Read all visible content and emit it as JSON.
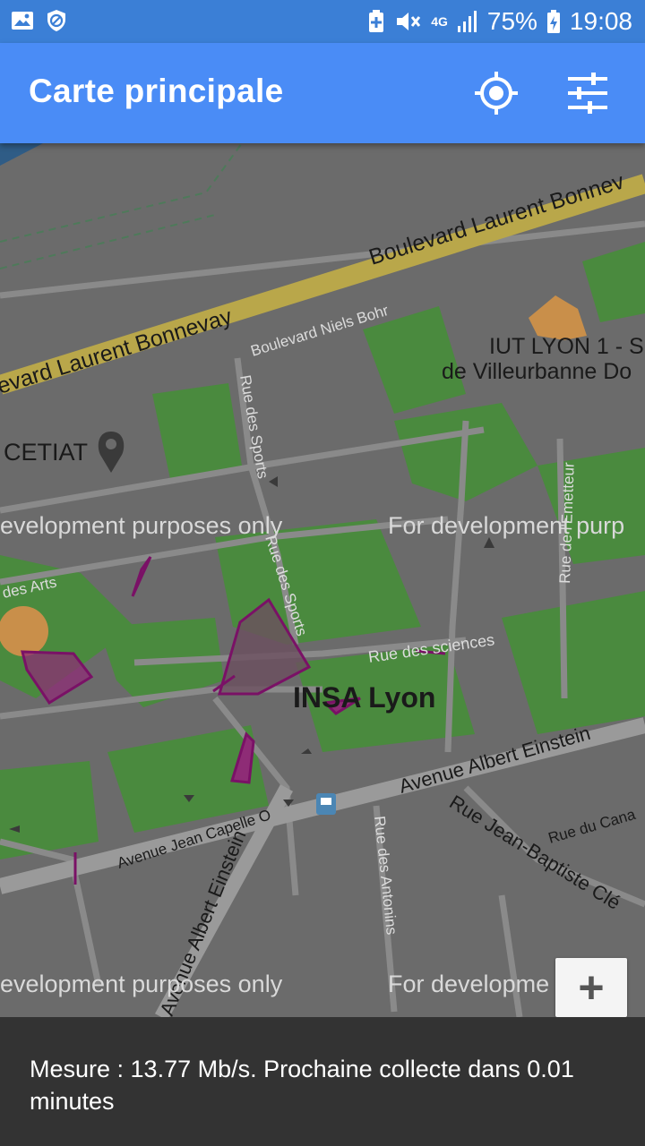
{
  "status_bar": {
    "battery": "75%",
    "network": "4G",
    "time": "19:08",
    "left_icons": [
      "image-icon",
      "shield-icon"
    ],
    "right_icons": [
      "battery-saver-icon",
      "mute-icon",
      "network-4g-icon",
      "signal-icon",
      "battery-charging-icon"
    ]
  },
  "app_bar": {
    "title": "Carte principale",
    "actions": [
      "locate-icon",
      "filter-settings-icon"
    ]
  },
  "map": {
    "watermark": "For development purposes only",
    "watermark_partial": "evelopment purposes only",
    "watermark_partial_right": "For development purp",
    "watermark_partial_right_2": "For developme",
    "labels": {
      "boulevard_laurent_bonnevay_1": "evard Laurent Bonnevay",
      "boulevard_laurent_bonnevay_2": "Boulevard Laurent Bonnev",
      "boulevard_niels_bohr": "Boulevard Niels Bohr",
      "iut_1": "IUT LYON 1 - S",
      "iut_2": "de Villeurbanne Do",
      "cetiat": "CETIAT",
      "rue_des_sports_1": "Rue des Sports",
      "rue_des_sports_2": "Rue des Sports",
      "rue_emetteur": "Rue de l'Emetteur",
      "rue_des_arts": "des Arts",
      "rue_des_sciences": "Rue des sciences",
      "insa": "INSA Lyon",
      "avenue_albert_einstein_1": "Avenue Albert Einstein",
      "avenue_jean_capelle": "Avenue Jean Capelle O",
      "rue_jean_baptiste": "Rue Jean-Baptiste Clé",
      "rue_du_canal": "Rue du Cana",
      "rue_des_antonins": "Rue des Antonins",
      "avenue_albert_einstein_2": "Avenue Albert Einstein"
    }
  },
  "zoom_button": {
    "label": "+"
  },
  "bottom_bar": {
    "measure_text": "Mesure : 13.77 Mb/s. Prochaine collecte dans 0.01 minutes"
  },
  "colors": {
    "status_bar": "#3b7fd6",
    "app_bar": "#4a8cf6",
    "map_base": "#6b6b6b",
    "green_area": "#4a8a3e",
    "road_major": "#b9a74a",
    "polygon_stroke": "#7a1166",
    "polygon_fill": "#8e2c76",
    "bottom_bar": "#333333"
  }
}
